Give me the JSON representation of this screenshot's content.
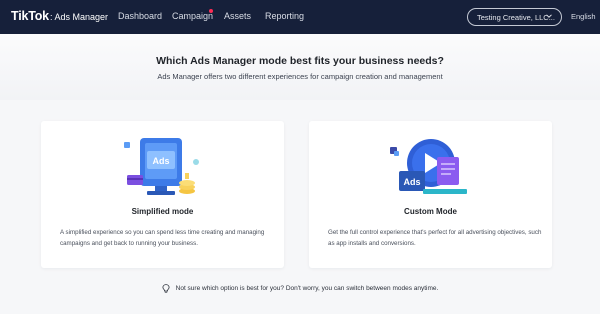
{
  "header": {
    "brand_logo": "TikTok",
    "brand_separator": ":",
    "brand_product": "Ads Manager",
    "nav": [
      {
        "label": "Dashboard"
      },
      {
        "label": "Campaign"
      },
      {
        "label": "Assets"
      },
      {
        "label": "Reporting"
      }
    ],
    "account_selector": "Testing Creative, LLC...",
    "language": "English"
  },
  "hero": {
    "title": "Which Ads Manager mode best fits your business needs?",
    "subtitle": "Ads Manager offers two different experiences for campaign creation and management"
  },
  "cards": {
    "simplified": {
      "title": "Simplified mode",
      "description": "A simplified experience so you can spend less time creating and managing campaigns and get back to running your business.",
      "illustration_badge": "Ads"
    },
    "custom": {
      "title": "Custom Mode",
      "description": "Get the full control experience that's perfect for all advertising objectives, such as app installs and conversions.",
      "illustration_badge": "Ads"
    }
  },
  "footnote": {
    "text": "Not sure which option is best for you? Don't worry, you can switch between modes anytime."
  },
  "colors": {
    "nav_background": "#16203a",
    "notification_dot": "#fe2c55",
    "illustration_blue": "#3d7be8",
    "illustration_purple": "#7b4fe0"
  },
  "icons": {
    "campaign_notification": "red-dot",
    "account_dropdown": "chevron-down-icon",
    "footnote": "lightbulb-icon"
  }
}
